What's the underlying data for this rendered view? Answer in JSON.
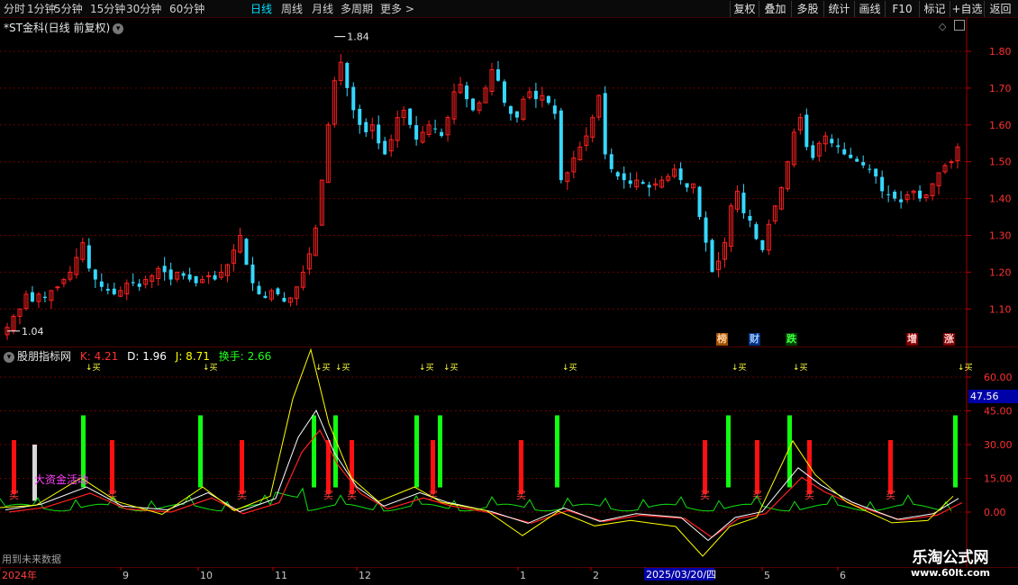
{
  "toolbar": {
    "periods": [
      "分时",
      "1分钟",
      "5分钟",
      "15分钟",
      "30分钟",
      "60分钟",
      "日线",
      "周线",
      "月线",
      "多周期",
      "更多"
    ],
    "active": "日线",
    "buttons": [
      "复权",
      "叠加",
      "多股",
      "统计",
      "画线",
      "F10",
      "标记",
      "+自选",
      "返回"
    ]
  },
  "main": {
    "title": "*ST金科(日线 前复权)",
    "high_label": "1.84",
    "low_label": "1.04",
    "yticks": [
      "1.80",
      "1.70",
      "1.60",
      "1.50",
      "1.40",
      "1.30",
      "1.20",
      "1.10"
    ],
    "tags": [
      "榜",
      "财",
      "跌",
      "增",
      "涨"
    ]
  },
  "indicator": {
    "name": "股朋指标网",
    "k_label": "K: 4.21",
    "d_label": "D: 1.96",
    "j_label": "J: 8.71",
    "turnover_label": "换手: 2.66",
    "yticks": [
      "60.00",
      "45.00",
      "30.00",
      "15.00",
      "0.00"
    ],
    "current_value": "47.56",
    "capital_label": "大资金活动",
    "buy_label": "买",
    "arrow_label": "↓买",
    "future_note": "用到未来数据",
    "colors": {
      "k": "#ffffff",
      "d": "#ffff00",
      "j": "#ff00ff",
      "turnover": "#00ff00",
      "buy_bar": "#ff1010",
      "sell_bar": "#00ff00"
    }
  },
  "timeaxis": {
    "labels": [
      "2024年",
      "9",
      "10",
      "11",
      "12",
      "1",
      "2",
      "3",
      "2025/03/20/四",
      "5",
      "6"
    ]
  },
  "watermark": {
    "title": "乐淘公式网",
    "url": "www.60lt.com"
  },
  "chart_data": {
    "type": "candlestick",
    "title": "*ST金科(日线 前复权)",
    "ylim": [
      1.04,
      1.86
    ],
    "high": 1.84,
    "low": 1.04,
    "closes": [
      1.05,
      1.08,
      1.1,
      1.14,
      1.12,
      1.14,
      1.13,
      1.15,
      1.16,
      1.18,
      1.2,
      1.24,
      1.28,
      1.21,
      1.18,
      1.16,
      1.15,
      1.14,
      1.15,
      1.17,
      1.17,
      1.16,
      1.18,
      1.19,
      1.21,
      1.2,
      1.18,
      1.2,
      1.19,
      1.18,
      1.17,
      1.18,
      1.19,
      1.18,
      1.2,
      1.22,
      1.26,
      1.3,
      1.22,
      1.17,
      1.14,
      1.13,
      1.15,
      1.14,
      1.12,
      1.13,
      1.16,
      1.2,
      1.25,
      1.32,
      1.45,
      1.6,
      1.72,
      1.77,
      1.7,
      1.64,
      1.6,
      1.58,
      1.6,
      1.55,
      1.52,
      1.56,
      1.62,
      1.64,
      1.6,
      1.56,
      1.58,
      1.6,
      1.59,
      1.57,
      1.62,
      1.69,
      1.71,
      1.67,
      1.64,
      1.66,
      1.7,
      1.75,
      1.72,
      1.66,
      1.63,
      1.62,
      1.67,
      1.69,
      1.67,
      1.68,
      1.66,
      1.63,
      1.45,
      1.47,
      1.51,
      1.54,
      1.57,
      1.62,
      1.68,
      1.52,
      1.48,
      1.46,
      1.45,
      1.44,
      1.45,
      1.44,
      1.43,
      1.44,
      1.45,
      1.46,
      1.48,
      1.45,
      1.43,
      1.44,
      1.35,
      1.28,
      1.2,
      1.23,
      1.28,
      1.38,
      1.42,
      1.36,
      1.34,
      1.29,
      1.26,
      1.33,
      1.38,
      1.43,
      1.5,
      1.58,
      1.62,
      1.54,
      1.51,
      1.55,
      1.57,
      1.55,
      1.54,
      1.52,
      1.51,
      1.5,
      1.49,
      1.48,
      1.46,
      1.42,
      1.41,
      1.4,
      1.39,
      1.41,
      1.42,
      1.4,
      1.41,
      1.44,
      1.47,
      1.49,
      1.5,
      1.54
    ],
    "kdj": {
      "ylim": [
        -12,
        70
      ],
      "yticks": [
        0,
        15,
        30,
        45,
        60
      ],
      "current": 47.56
    }
  }
}
